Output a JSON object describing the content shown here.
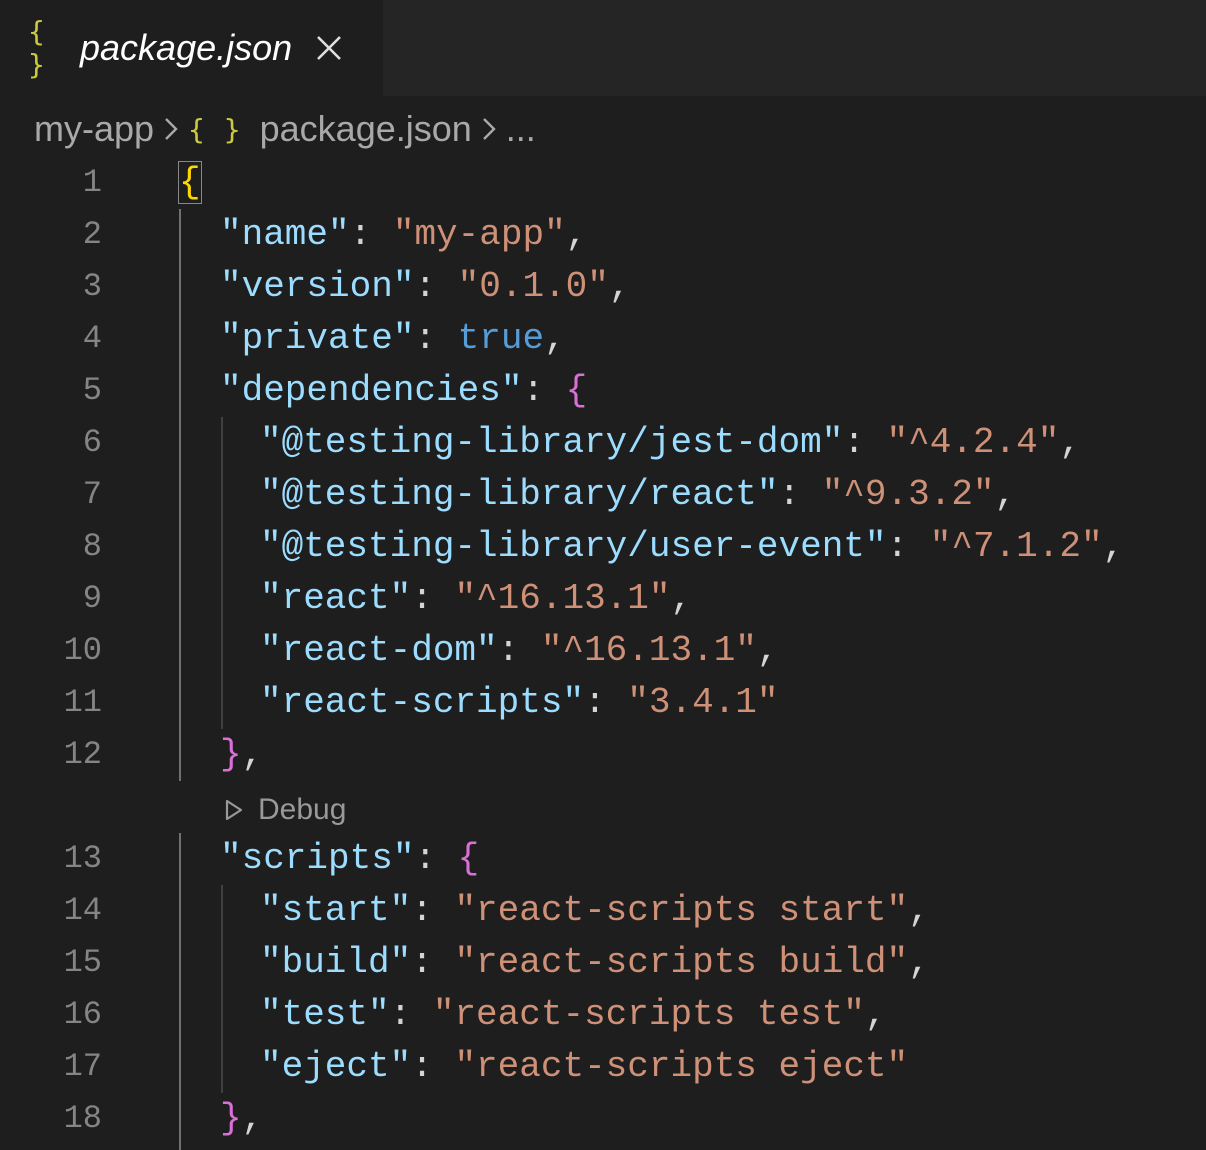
{
  "tab": {
    "icon": "{ }",
    "label": "package.json",
    "close_icon": "close-icon"
  },
  "breadcrumb": {
    "folder": "my-app",
    "icon": "{ }",
    "file": "package.json",
    "more": "..."
  },
  "codelens": {
    "label": "Debug"
  },
  "lines": [
    {
      "n": "1"
    },
    {
      "n": "2",
      "key": "\"name\"",
      "colon": ": ",
      "value": "\"my-app\"",
      "trail": ","
    },
    {
      "n": "3",
      "key": "\"version\"",
      "colon": ": ",
      "value": "\"0.1.0\"",
      "trail": ","
    },
    {
      "n": "4",
      "key": "\"private\"",
      "colon": ": ",
      "value": "true",
      "trail": ","
    },
    {
      "n": "5",
      "key": "\"dependencies\"",
      "colon": ": ",
      "open": "{"
    },
    {
      "n": "6",
      "key": "\"@testing-library/jest-dom\"",
      "colon": ": ",
      "value": "\"^4.2.4\"",
      "trail": ","
    },
    {
      "n": "7",
      "key": "\"@testing-library/react\"",
      "colon": ": ",
      "value": "\"^9.3.2\"",
      "trail": ","
    },
    {
      "n": "8",
      "key": "\"@testing-library/user-event\"",
      "colon": ": ",
      "value": "\"^7.1.2\"",
      "trail": ","
    },
    {
      "n": "9",
      "key": "\"react\"",
      "colon": ": ",
      "value": "\"^16.13.1\"",
      "trail": ","
    },
    {
      "n": "10",
      "key": "\"react-dom\"",
      "colon": ": ",
      "value": "\"^16.13.1\"",
      "trail": ","
    },
    {
      "n": "11",
      "key": "\"react-scripts\"",
      "colon": ": ",
      "value": "\"3.4.1\"",
      "trail": ""
    },
    {
      "n": "12",
      "close": "}",
      "trail": ","
    },
    {
      "n": "13",
      "key": "\"scripts\"",
      "colon": ": ",
      "open": "{"
    },
    {
      "n": "14",
      "key": "\"start\"",
      "colon": ": ",
      "value": "\"react-scripts start\"",
      "trail": ","
    },
    {
      "n": "15",
      "key": "\"build\"",
      "colon": ": ",
      "value": "\"react-scripts build\"",
      "trail": ","
    },
    {
      "n": "16",
      "key": "\"test\"",
      "colon": ": ",
      "value": "\"react-scripts test\"",
      "trail": ","
    },
    {
      "n": "17",
      "key": "\"eject\"",
      "colon": ": ",
      "value": "\"react-scripts eject\"",
      "trail": ""
    },
    {
      "n": "18",
      "close": "}",
      "trail": ","
    }
  ],
  "root_open": "{",
  "colors": {
    "key": "#9cdcfe",
    "string": "#ce9178",
    "keyword": "#569cd6",
    "bracket_level1": "#ffd700",
    "bracket_level2": "#da70d6",
    "json_icon": "#cbcb41",
    "background": "#1e1e1e"
  }
}
